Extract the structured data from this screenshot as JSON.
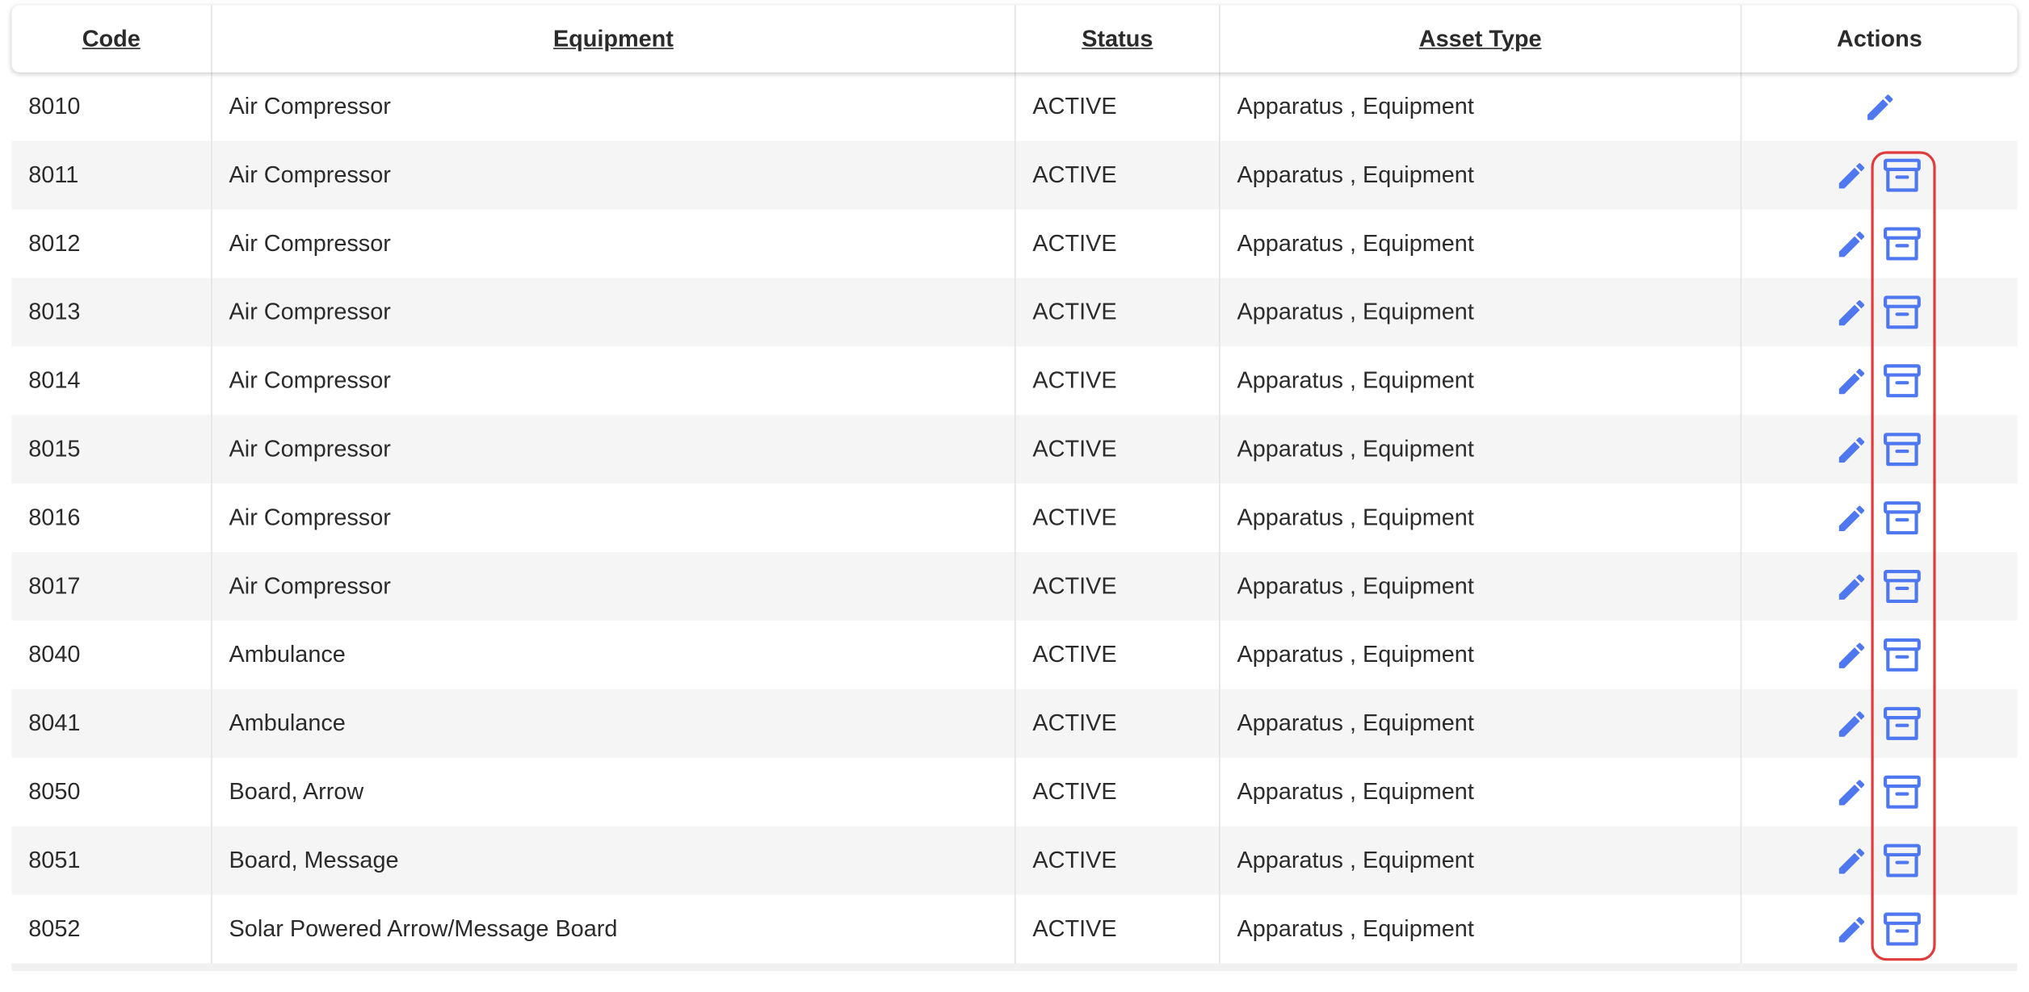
{
  "table": {
    "columns": [
      {
        "label": "Code",
        "sortable": true
      },
      {
        "label": "Equipment",
        "sortable": true
      },
      {
        "label": "Status",
        "sortable": true
      },
      {
        "label": "Asset Type",
        "sortable": true
      },
      {
        "label": "Actions",
        "sortable": false
      }
    ],
    "rows": [
      {
        "code": "8010",
        "equipment": "Air Compressor",
        "status": "ACTIVE",
        "asset_type": "Apparatus , Equipment",
        "archivable": false
      },
      {
        "code": "8011",
        "equipment": "Air Compressor",
        "status": "ACTIVE",
        "asset_type": "Apparatus , Equipment",
        "archivable": true
      },
      {
        "code": "8012",
        "equipment": "Air Compressor",
        "status": "ACTIVE",
        "asset_type": "Apparatus , Equipment",
        "archivable": true
      },
      {
        "code": "8013",
        "equipment": "Air Compressor",
        "status": "ACTIVE",
        "asset_type": "Apparatus , Equipment",
        "archivable": true
      },
      {
        "code": "8014",
        "equipment": "Air Compressor",
        "status": "ACTIVE",
        "asset_type": "Apparatus , Equipment",
        "archivable": true
      },
      {
        "code": "8015",
        "equipment": "Air Compressor",
        "status": "ACTIVE",
        "asset_type": "Apparatus , Equipment",
        "archivable": true
      },
      {
        "code": "8016",
        "equipment": "Air Compressor",
        "status": "ACTIVE",
        "asset_type": "Apparatus , Equipment",
        "archivable": true
      },
      {
        "code": "8017",
        "equipment": "Air Compressor",
        "status": "ACTIVE",
        "asset_type": "Apparatus , Equipment",
        "archivable": true
      },
      {
        "code": "8040",
        "equipment": "Ambulance",
        "status": "ACTIVE",
        "asset_type": "Apparatus , Equipment",
        "archivable": true
      },
      {
        "code": "8041",
        "equipment": "Ambulance",
        "status": "ACTIVE",
        "asset_type": "Apparatus , Equipment",
        "archivable": true
      },
      {
        "code": "8050",
        "equipment": "Board, Arrow",
        "status": "ACTIVE",
        "asset_type": "Apparatus , Equipment",
        "archivable": true
      },
      {
        "code": "8051",
        "equipment": "Board, Message",
        "status": "ACTIVE",
        "asset_type": "Apparatus , Equipment",
        "archivable": true
      },
      {
        "code": "8052",
        "equipment": "Solar Powered Arrow/Message Board",
        "status": "ACTIVE",
        "asset_type": "Apparatus , Equipment",
        "archivable": true
      }
    ]
  },
  "icons": {
    "edit": "pencil-icon",
    "archive": "archive-box-icon"
  },
  "colors": {
    "icon_blue": "#4f77f0",
    "highlight_red": "#e23b3b",
    "row_alt": "#f5f5f5"
  }
}
